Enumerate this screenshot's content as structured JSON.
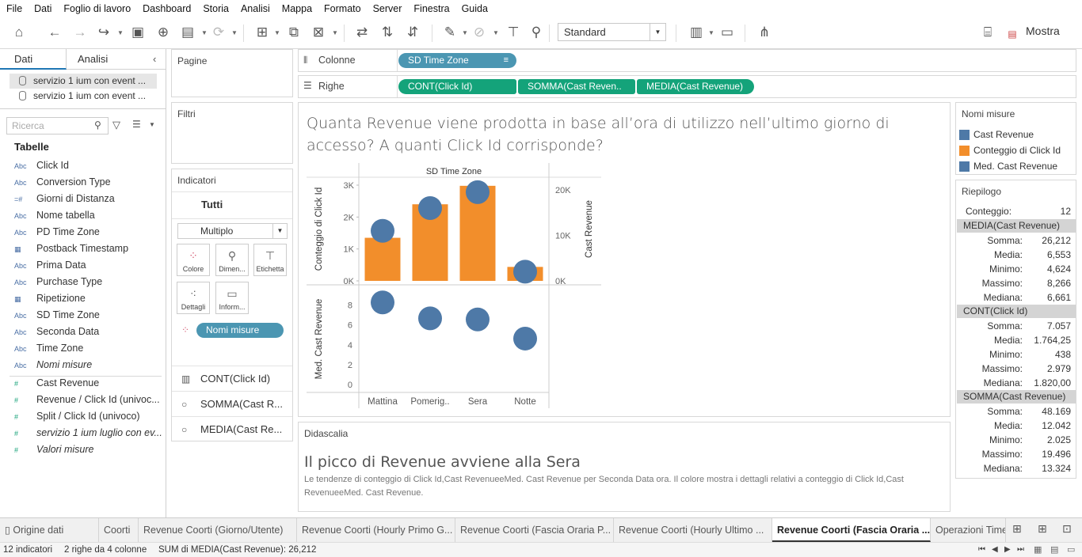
{
  "menu": [
    "File",
    "Dati",
    "Foglio di lavoro",
    "Dashboard",
    "Storia",
    "Analisi",
    "Mappa",
    "Formato",
    "Server",
    "Finestra",
    "Guida"
  ],
  "toolbar": {
    "view_mode": "Standard",
    "show_me": "Mostra"
  },
  "left": {
    "tab_data": "Dati",
    "tab_analysis": "Analisi",
    "datasources": [
      "servizio 1 ium con event ...",
      "servizio 1 ium con event ..."
    ],
    "search_placeholder": "Ricerca",
    "tables_title": "Tabelle",
    "dimensions": [
      {
        "icon": "Abc",
        "name": "Click Id"
      },
      {
        "icon": "Abc",
        "name": "Conversion Type"
      },
      {
        "icon": "#",
        "name": "Giorni di Distanza"
      },
      {
        "icon": "Abc",
        "name": "Nome tabella"
      },
      {
        "icon": "Abc",
        "name": "PD Time Zone"
      },
      {
        "icon": "cal",
        "name": "Postback Timestamp"
      },
      {
        "icon": "Abc",
        "name": "Prima Data"
      },
      {
        "icon": "Abc",
        "name": "Purchase Type"
      },
      {
        "icon": "cal",
        "name": "Ripetizione"
      },
      {
        "icon": "Abc",
        "name": "SD Time Zone"
      },
      {
        "icon": "Abc",
        "name": "Seconda Data"
      },
      {
        "icon": "Abc",
        "name": "Time Zone"
      },
      {
        "icon": "Abc",
        "name": "Nomi misure",
        "italic": true
      }
    ],
    "measures": [
      {
        "name": "Cast Revenue"
      },
      {
        "name": "Revenue / Click Id (univoc..."
      },
      {
        "name": "Split / Click Id (univoco)"
      },
      {
        "name": "servizio 1 ium luglio con ev...",
        "italic": true
      },
      {
        "name": "Valori misure",
        "italic": true
      }
    ]
  },
  "shelves": {
    "pages": "Pagine",
    "filters": "Filtri",
    "columns_label": "Colonne",
    "rows_label": "Righe",
    "columns_pills": [
      "SD Time Zone"
    ],
    "rows_pills": [
      "CONT(Click Id)",
      "SOMMA(Cast Reven..",
      "MEDIA(Cast Revenue)"
    ]
  },
  "marks": {
    "title": "Indicatori",
    "all": "Tutti",
    "type": "Multiplo",
    "buttons": [
      "Colore",
      "Dimen...",
      "Etichetta",
      "Dettagli",
      "Inform..."
    ],
    "color_pill": "Nomi misure",
    "rows": [
      "CONT(Click Id)",
      "SOMMA(Cast R...",
      "MEDIA(Cast Re..."
    ]
  },
  "view": {
    "title": "Quanta Revenue viene prodotta in base all’ora di utilizzo nell’ultimo giorno di accesso? A quanti Click Id corrisponde?"
  },
  "chart_data": {
    "type": "bar",
    "title": "Quanta Revenue viene prodotta in base all’ora di utilizzo nell’ultimo giorno di accesso? A quanti Click Id corrisponde?",
    "header": "SD Time Zone",
    "categories": [
      "Mattina",
      "Pomerig..",
      "Sera",
      "Notte"
    ],
    "series": [
      {
        "name": "Conteggio di Click Id",
        "values": [
          1350,
          2400,
          2979,
          438
        ],
        "color": "#f28e2b",
        "mark": "bar",
        "axis": "Conteggio di Click Id",
        "ylim": [
          0,
          3000
        ],
        "ticks": [
          "0K",
          "1K",
          "2K",
          "3K"
        ]
      },
      {
        "name": "Cast Revenue",
        "values": [
          11000,
          16000,
          19496,
          2025
        ],
        "color": "#4e79a7",
        "mark": "circle",
        "axis": "Cast Revenue",
        "ylim": [
          0,
          20000
        ],
        "ticks": [
          "0K",
          "10K",
          "20K"
        ]
      },
      {
        "name": "Med. Cast Revenue",
        "values": [
          8.266,
          6.661,
          6.553,
          4.624
        ],
        "color": "#4e79a7",
        "mark": "circle",
        "axis": "Med. Cast Revenue",
        "ylim": [
          0,
          9
        ],
        "ticks": [
          "0",
          "2",
          "4",
          "6",
          "8"
        ]
      }
    ]
  },
  "caption": {
    "label": "Didascalia",
    "heading": "Il picco di Revenue avviene alla Sera",
    "text": "Le tendenze di conteggio di Click Id,Cast RevenueeMed. Cast Revenue per Seconda Data ora. Il colore mostra i dettagli relativi a conteggio di Click Id,Cast RevenueeMed. Cast Revenue."
  },
  "legend": {
    "title": "Nomi misure",
    "items": [
      {
        "label": "Cast Revenue",
        "color": "#4e79a7"
      },
      {
        "label": "Conteggio di Click Id",
        "color": "#f28e2b"
      },
      {
        "label": "Med. Cast Revenue",
        "color": "#4e79a7"
      }
    ]
  },
  "summary": {
    "title": "Riepilogo",
    "count_label": "Conteggio:",
    "count_value": "12",
    "groups": [
      {
        "name": "MEDIA(Cast Revenue)",
        "rows": [
          [
            "Somma:",
            "26,212"
          ],
          [
            "Media:",
            "6,553"
          ],
          [
            "Minimo:",
            "4,624"
          ],
          [
            "Massimo:",
            "8,266"
          ],
          [
            "Mediana:",
            "6,661"
          ]
        ]
      },
      {
        "name": "CONT(Click Id)",
        "rows": [
          [
            "Somma:",
            "7.057"
          ],
          [
            "Media:",
            "1.764,25"
          ],
          [
            "Minimo:",
            "438"
          ],
          [
            "Massimo:",
            "2.979"
          ],
          [
            "Mediana:",
            "1.820,00"
          ]
        ]
      },
      {
        "name": "SOMMA(Cast Revenue)",
        "rows": [
          [
            "Somma:",
            "48.169"
          ],
          [
            "Media:",
            "12.042"
          ],
          [
            "Minimo:",
            "2.025"
          ],
          [
            "Massimo:",
            "19.496"
          ],
          [
            "Mediana:",
            "13.324"
          ]
        ]
      }
    ]
  },
  "sheet_tabs": [
    "Origine dati",
    "Coorti",
    "Revenue Coorti (Giorno/Utente)",
    "Revenue Coorti (Hourly Primo G...",
    "Revenue Coorti (Fascia Oraria P...",
    "Revenue Coorti (Hourly Ultimo ...",
    "Revenue Coorti (Fascia Oraria ...",
    "Operazioni Time"
  ],
  "active_tab": 6,
  "status": {
    "marks": "12 indicatori",
    "rows_cols": "2 righe da 4 colonne",
    "sum": "SUM di MEDIA(Cast Revenue): 26,212"
  }
}
